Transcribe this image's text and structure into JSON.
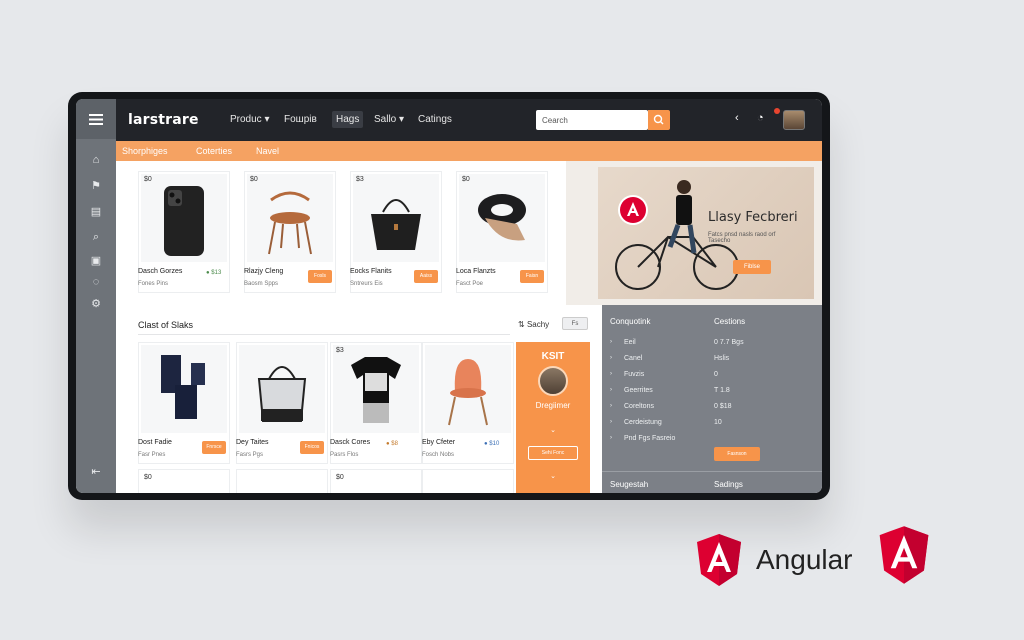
{
  "topbar": {
    "brand": "larstrare",
    "nav": [
      "Produc",
      "Fошрів",
      "Hags",
      "Sallo",
      "Catings"
    ],
    "search_placeholder": "Cearch"
  },
  "subbar": [
    "Shorphiges",
    "Coterties",
    "Navel"
  ],
  "products_row1": [
    {
      "price": "$0",
      "name": "Dasch Gorzes",
      "sub": "Fones Pins",
      "action": "● $13"
    },
    {
      "price": "$0",
      "name": "Rlazjy Cleng",
      "sub": "Baosm Spps",
      "action": "Fosls"
    },
    {
      "price": "$3",
      "name": "Eocks Flanits",
      "sub": "Sntreurs Eis",
      "action": "Aaiss"
    },
    {
      "price": "$0",
      "name": "Loca Flanzts",
      "sub": "Fasct Poe",
      "action": "Faisn"
    }
  ],
  "section": {
    "title": "Clast of Slaks",
    "sort_label": "Sachy",
    "sort_value": "Fs"
  },
  "products_row2": [
    {
      "price": "",
      "name": "Dost Fadie",
      "sub": "Fasr Pnes",
      "action": "Fnrsce"
    },
    {
      "price": "",
      "name": "Dey Taites",
      "sub": "Fasrs Pgs",
      "action": "Fnicos"
    },
    {
      "price": "$3",
      "name": "Dasck Cores",
      "sub": "Pasrs Flos",
      "action": "● $8"
    },
    {
      "price": "",
      "name": "Eby Cfeter",
      "sub": "Fosch Nobs",
      "action": "● $10"
    }
  ],
  "products_row3_prices": [
    "$0",
    "",
    "$0",
    ""
  ],
  "hero": {
    "title": "Llasy Fecbreri",
    "subtitle": "Fatcs pnsd nasls raod orf Tasecho",
    "button": "Fiblse"
  },
  "promo": {
    "title": "KSIT",
    "name": "Dregiimer",
    "button": "Sehi Fonc"
  },
  "right_panel": {
    "left_head": "Conquotink",
    "right_head": "Cestions",
    "rows": [
      {
        "l": "Eeil",
        "r": "0  7.7 Bgs"
      },
      {
        "l": "Canel",
        "r": "Hslis"
      },
      {
        "l": "Fuvzis",
        "r": "0"
      },
      {
        "l": "Geerrites",
        "r": "T  1.8"
      },
      {
        "l": "Coreltons",
        "r": "0  $18"
      },
      {
        "l": "Cerdeistung",
        "r": "10"
      },
      {
        "l": "Pnd Fgs Fasreio",
        "r": ""
      }
    ],
    "button": "Fasnson",
    "foot_left": "Seugestah",
    "foot_right": "Sadings"
  },
  "logo": {
    "word": "Angular"
  },
  "colors": {
    "accent": "#f7944a",
    "topbar": "#222429",
    "sidebar": "#6e7379",
    "panel": "#7c8087",
    "angular_red": "#dd0031"
  }
}
